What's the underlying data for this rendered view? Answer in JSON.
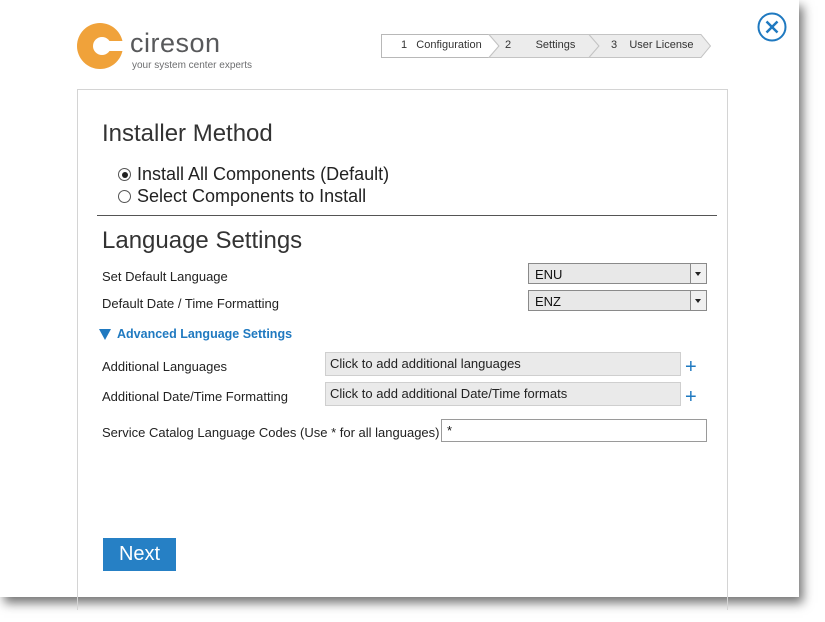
{
  "logo": {
    "name": "cireson",
    "tagline": "your system center experts",
    "brand_color": "#f0a23a"
  },
  "steps": [
    {
      "num": "1",
      "label": "Configuration",
      "active": true
    },
    {
      "num": "2",
      "label": "Settings",
      "active": false
    },
    {
      "num": "3",
      "label": "User License",
      "active": false
    }
  ],
  "installer": {
    "title": "Installer Method",
    "options": [
      {
        "label": "Install All Components (Default)",
        "selected": true
      },
      {
        "label": "Select Components to Install",
        "selected": false
      }
    ]
  },
  "language": {
    "title": "Language Settings",
    "default_language_label": "Set  Default Language",
    "default_language_value": "ENU",
    "date_format_label": "Default Date / Time Formatting",
    "date_format_value": "ENZ",
    "advanced_label": "Advanced Language Settings",
    "additional_languages_label": "Additional Languages",
    "additional_languages_placeholder": "Click to add additional languages",
    "additional_formats_label": "Additional Date/Time Formatting",
    "additional_formats_placeholder": "Click to add additional Date/Time formats",
    "catalog_codes_label": "Service Catalog Language Codes (Use * for all languages)",
    "catalog_codes_value": "*"
  },
  "next_label": "Next",
  "accent_color": "#1f79c0"
}
